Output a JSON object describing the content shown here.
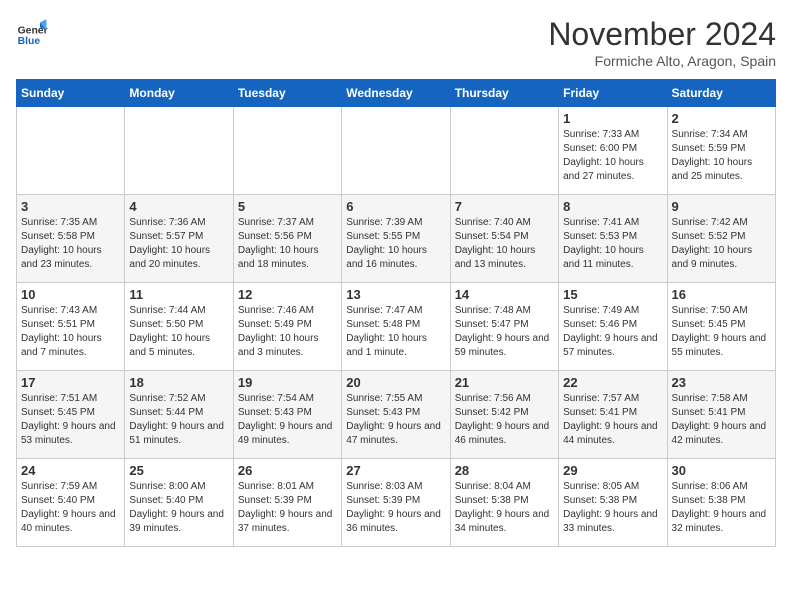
{
  "header": {
    "logo_line1": "General",
    "logo_line2": "Blue",
    "month": "November 2024",
    "location": "Formiche Alto, Aragon, Spain"
  },
  "days_of_week": [
    "Sunday",
    "Monday",
    "Tuesday",
    "Wednesday",
    "Thursday",
    "Friday",
    "Saturday"
  ],
  "weeks": [
    [
      {
        "day": "",
        "info": ""
      },
      {
        "day": "",
        "info": ""
      },
      {
        "day": "",
        "info": ""
      },
      {
        "day": "",
        "info": ""
      },
      {
        "day": "",
        "info": ""
      },
      {
        "day": "1",
        "info": "Sunrise: 7:33 AM\nSunset: 6:00 PM\nDaylight: 10 hours and 27 minutes."
      },
      {
        "day": "2",
        "info": "Sunrise: 7:34 AM\nSunset: 5:59 PM\nDaylight: 10 hours and 25 minutes."
      }
    ],
    [
      {
        "day": "3",
        "info": "Sunrise: 7:35 AM\nSunset: 5:58 PM\nDaylight: 10 hours and 23 minutes."
      },
      {
        "day": "4",
        "info": "Sunrise: 7:36 AM\nSunset: 5:57 PM\nDaylight: 10 hours and 20 minutes."
      },
      {
        "day": "5",
        "info": "Sunrise: 7:37 AM\nSunset: 5:56 PM\nDaylight: 10 hours and 18 minutes."
      },
      {
        "day": "6",
        "info": "Sunrise: 7:39 AM\nSunset: 5:55 PM\nDaylight: 10 hours and 16 minutes."
      },
      {
        "day": "7",
        "info": "Sunrise: 7:40 AM\nSunset: 5:54 PM\nDaylight: 10 hours and 13 minutes."
      },
      {
        "day": "8",
        "info": "Sunrise: 7:41 AM\nSunset: 5:53 PM\nDaylight: 10 hours and 11 minutes."
      },
      {
        "day": "9",
        "info": "Sunrise: 7:42 AM\nSunset: 5:52 PM\nDaylight: 10 hours and 9 minutes."
      }
    ],
    [
      {
        "day": "10",
        "info": "Sunrise: 7:43 AM\nSunset: 5:51 PM\nDaylight: 10 hours and 7 minutes."
      },
      {
        "day": "11",
        "info": "Sunrise: 7:44 AM\nSunset: 5:50 PM\nDaylight: 10 hours and 5 minutes."
      },
      {
        "day": "12",
        "info": "Sunrise: 7:46 AM\nSunset: 5:49 PM\nDaylight: 10 hours and 3 minutes."
      },
      {
        "day": "13",
        "info": "Sunrise: 7:47 AM\nSunset: 5:48 PM\nDaylight: 10 hours and 1 minute."
      },
      {
        "day": "14",
        "info": "Sunrise: 7:48 AM\nSunset: 5:47 PM\nDaylight: 9 hours and 59 minutes."
      },
      {
        "day": "15",
        "info": "Sunrise: 7:49 AM\nSunset: 5:46 PM\nDaylight: 9 hours and 57 minutes."
      },
      {
        "day": "16",
        "info": "Sunrise: 7:50 AM\nSunset: 5:45 PM\nDaylight: 9 hours and 55 minutes."
      }
    ],
    [
      {
        "day": "17",
        "info": "Sunrise: 7:51 AM\nSunset: 5:45 PM\nDaylight: 9 hours and 53 minutes."
      },
      {
        "day": "18",
        "info": "Sunrise: 7:52 AM\nSunset: 5:44 PM\nDaylight: 9 hours and 51 minutes."
      },
      {
        "day": "19",
        "info": "Sunrise: 7:54 AM\nSunset: 5:43 PM\nDaylight: 9 hours and 49 minutes."
      },
      {
        "day": "20",
        "info": "Sunrise: 7:55 AM\nSunset: 5:43 PM\nDaylight: 9 hours and 47 minutes."
      },
      {
        "day": "21",
        "info": "Sunrise: 7:56 AM\nSunset: 5:42 PM\nDaylight: 9 hours and 46 minutes."
      },
      {
        "day": "22",
        "info": "Sunrise: 7:57 AM\nSunset: 5:41 PM\nDaylight: 9 hours and 44 minutes."
      },
      {
        "day": "23",
        "info": "Sunrise: 7:58 AM\nSunset: 5:41 PM\nDaylight: 9 hours and 42 minutes."
      }
    ],
    [
      {
        "day": "24",
        "info": "Sunrise: 7:59 AM\nSunset: 5:40 PM\nDaylight: 9 hours and 40 minutes."
      },
      {
        "day": "25",
        "info": "Sunrise: 8:00 AM\nSunset: 5:40 PM\nDaylight: 9 hours and 39 minutes."
      },
      {
        "day": "26",
        "info": "Sunrise: 8:01 AM\nSunset: 5:39 PM\nDaylight: 9 hours and 37 minutes."
      },
      {
        "day": "27",
        "info": "Sunrise: 8:03 AM\nSunset: 5:39 PM\nDaylight: 9 hours and 36 minutes."
      },
      {
        "day": "28",
        "info": "Sunrise: 8:04 AM\nSunset: 5:38 PM\nDaylight: 9 hours and 34 minutes."
      },
      {
        "day": "29",
        "info": "Sunrise: 8:05 AM\nSunset: 5:38 PM\nDaylight: 9 hours and 33 minutes."
      },
      {
        "day": "30",
        "info": "Sunrise: 8:06 AM\nSunset: 5:38 PM\nDaylight: 9 hours and 32 minutes."
      }
    ]
  ]
}
